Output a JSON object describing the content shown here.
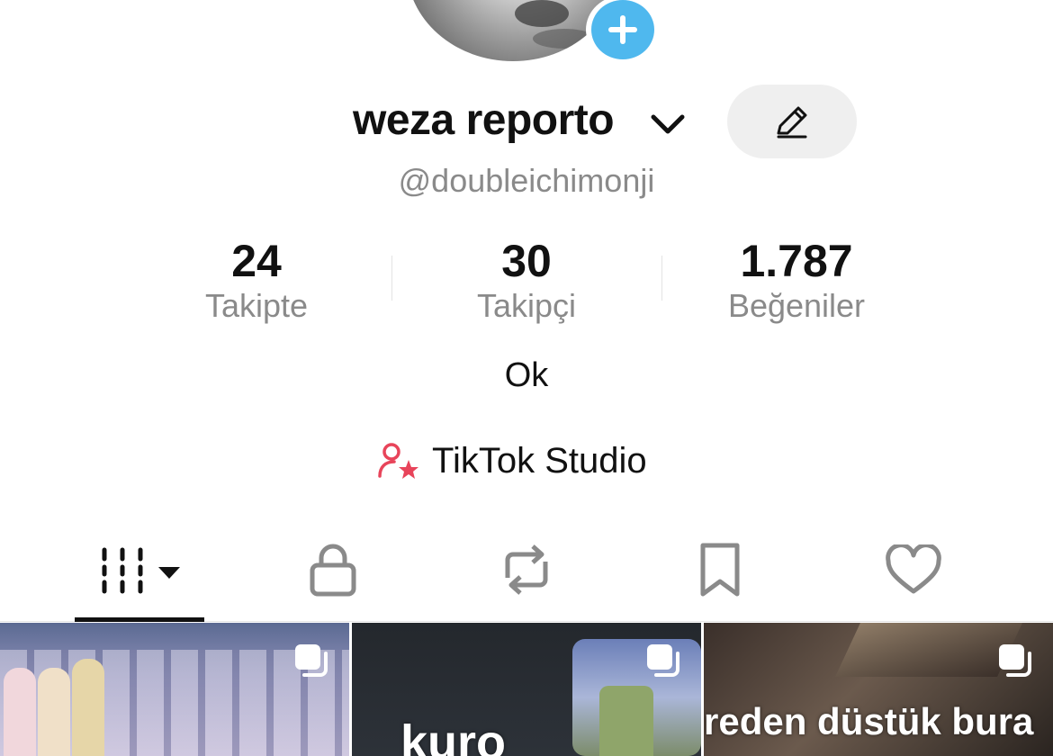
{
  "profile": {
    "display_name": "weza reporto",
    "username": "@doubleichimonji",
    "bio": "Ok"
  },
  "stats": [
    {
      "value": "24",
      "label": "Takipte"
    },
    {
      "value": "30",
      "label": "Takipçi"
    },
    {
      "value": "1.787",
      "label": "Beğeniler"
    }
  ],
  "studio": {
    "label": "TikTok Studio",
    "icon": "creator-star-icon",
    "accent": "#e8445a"
  },
  "tabs": [
    {
      "icon": "grid-videos-icon",
      "active": true
    },
    {
      "icon": "lock-icon",
      "active": false
    },
    {
      "icon": "repost-icon",
      "active": false
    },
    {
      "icon": "bookmark-icon",
      "active": false
    },
    {
      "icon": "heart-icon",
      "active": false
    }
  ],
  "videos": [
    {
      "overlay_text": "",
      "badge": "multi-photo-icon"
    },
    {
      "overlay_text": "kuro",
      "badge": "multi-photo-icon"
    },
    {
      "overlay_text": "reden düstük bura",
      "badge": "multi-photo-icon"
    }
  ],
  "colors": {
    "add_badge": "#4fb8ee",
    "secondary_text": "#8a8a8a"
  }
}
